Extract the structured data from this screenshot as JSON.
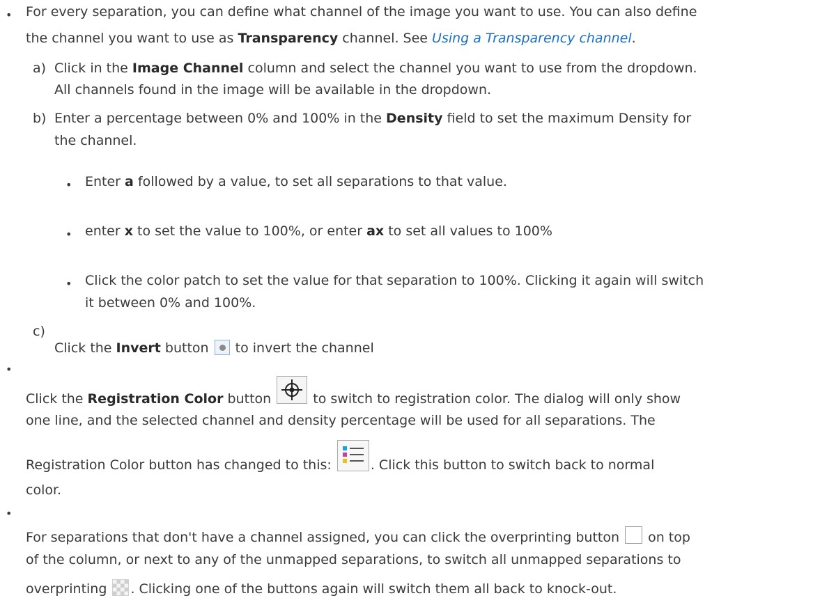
{
  "item1": {
    "l1": "For every separation, you can define what channel of the image you want to use. You can also define",
    "l2a": "the channel you want to use as ",
    "l2b": "Transparency",
    "l2c": " channel. See ",
    "l2link": "Using a Transparency channel",
    "l2d": "."
  },
  "sub_a": {
    "marker": "a)",
    "l1a": "Click in the ",
    "l1b": "Image Channel",
    "l1c": " column and select the channel you want to use from the dropdown.",
    "l2": "All channels found in the image will be available in the dropdown."
  },
  "sub_b": {
    "marker": "b)",
    "l1a": "Enter a percentage between 0% and 100% in the ",
    "l1b": "Density",
    "l1c": " field to set the maximum Density for",
    "l2": "the channel."
  },
  "b1": {
    "a": "Enter ",
    "b": "a",
    "c": " followed by a value, to set all separations to that value."
  },
  "b2": {
    "a": "enter ",
    "b": "x",
    "c": " to set the value to 100%, or enter ",
    "d": "ax",
    "e": " to set all values to 100%"
  },
  "b3": {
    "l1": "Click the color patch to set the value for that separation to 100%. Clicking it again will switch",
    "l2": "it between 0% and 100%."
  },
  "sub_c": {
    "marker": "c)",
    "a": "Click the ",
    "b": "Invert",
    "c": " button ",
    "d": " to invert the channel"
  },
  "item2": {
    "l1a": "Click the ",
    "l1b": "Registration Color",
    "l1c": " button ",
    "l1d": " to switch to registration color. The dialog will only show",
    "l2": "one line, and the selected channel and density percentage will be used for all separations. The",
    "l3a": "Registration Color button has changed to this: ",
    "l3b": ". Click this button to switch back to normal",
    "l4": "color."
  },
  "item3": {
    "l1a": "For separations that don't have a channel assigned, you can click the overprinting button ",
    "l1b": " on top",
    "l2": "of the column, or next to any of the unmapped separations, to switch all unmapped separations to",
    "l3a": "overprinting ",
    "l3b": ". Clicking one of the buttons again will switch them all back to knock-out."
  },
  "colors": {
    "text": "#3a3a3a",
    "link": "#1a6fc9",
    "button_border": "#8fb2d8"
  },
  "icons": [
    "invert-icon",
    "registration-target-icon",
    "color-list-icon",
    "overprint-empty-icon",
    "overprint-checker-icon"
  ]
}
